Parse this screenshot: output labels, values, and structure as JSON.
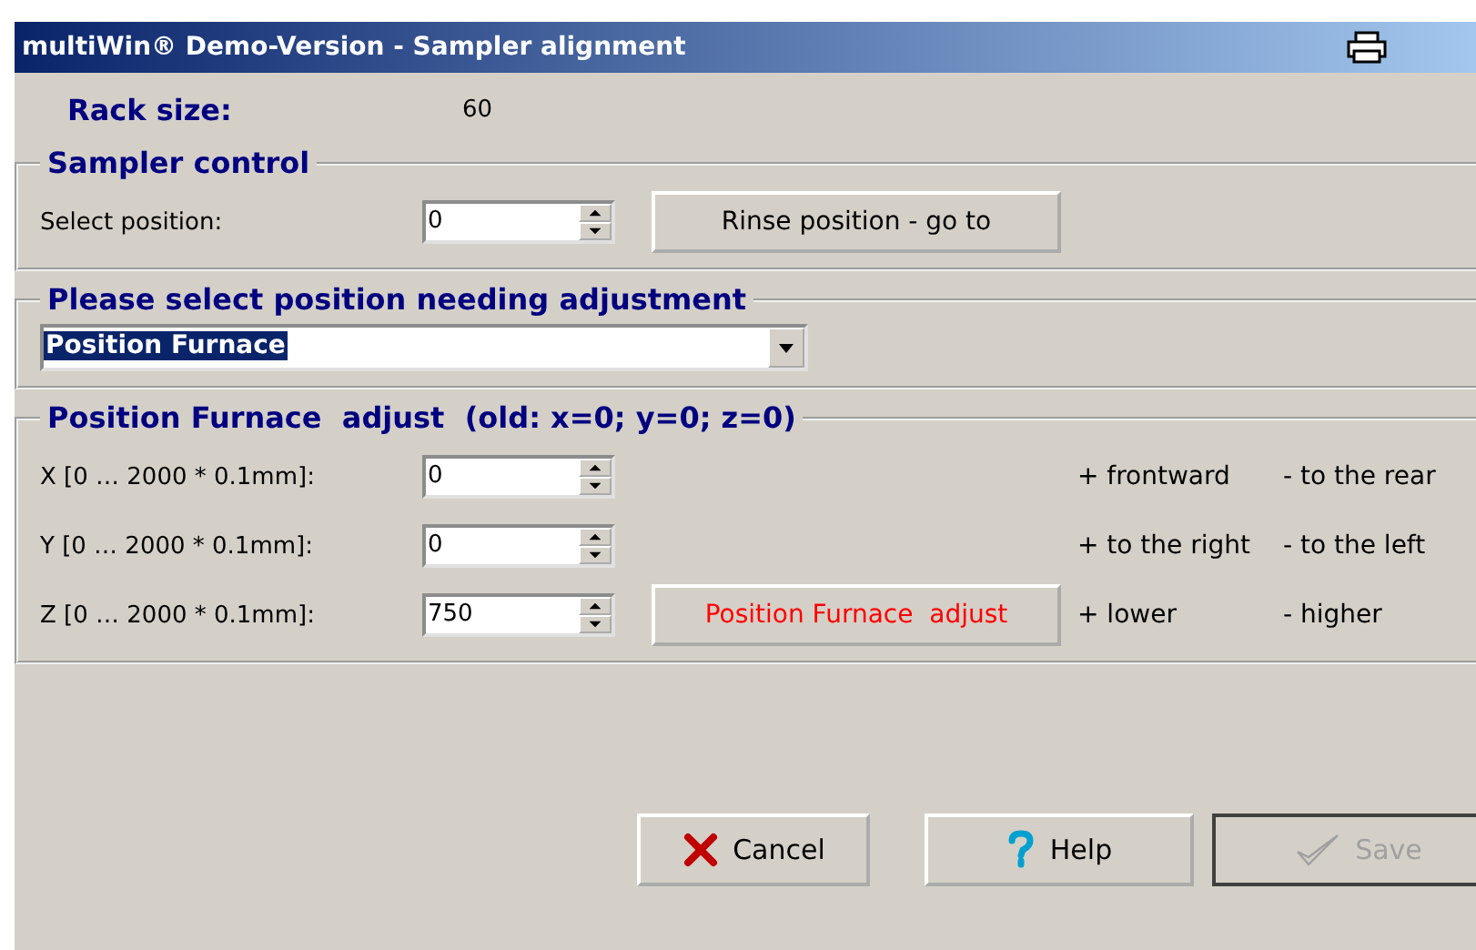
{
  "window": {
    "title": "multiWin® Demo-Version - Sampler alignment"
  },
  "rack": {
    "label": "Rack size:",
    "value": "60"
  },
  "sampler_control": {
    "title": "Sampler control",
    "label": "Select position:",
    "value": "0",
    "button": "Rinse position - go to"
  },
  "position_select": {
    "title": "Please select position needing adjustment",
    "value": "Position Furnace"
  },
  "adjust": {
    "title": "Position Furnace  adjust  (old: x=0; y=0; z=0)",
    "rows": [
      {
        "label": "X [0 … 2000 * 0.1mm]:",
        "value": "0",
        "plus": "+ frontward",
        "minus": "- to the rear"
      },
      {
        "label": "Y [0 … 2000 * 0.1mm]:",
        "value": "0",
        "plus": "+ to the right",
        "minus": "- to the left"
      },
      {
        "label": "Z [0 … 2000 * 0.1mm]:",
        "value": "750",
        "button": "Position Furnace  adjust",
        "plus": "+ lower",
        "minus": "- higher"
      }
    ]
  },
  "buttons": [
    {
      "kind": "cancel",
      "label": "Cancel",
      "disabled": false
    },
    {
      "kind": "help",
      "label": "Help",
      "disabled": false
    },
    {
      "kind": "save",
      "label": "Save",
      "disabled": true
    }
  ]
}
